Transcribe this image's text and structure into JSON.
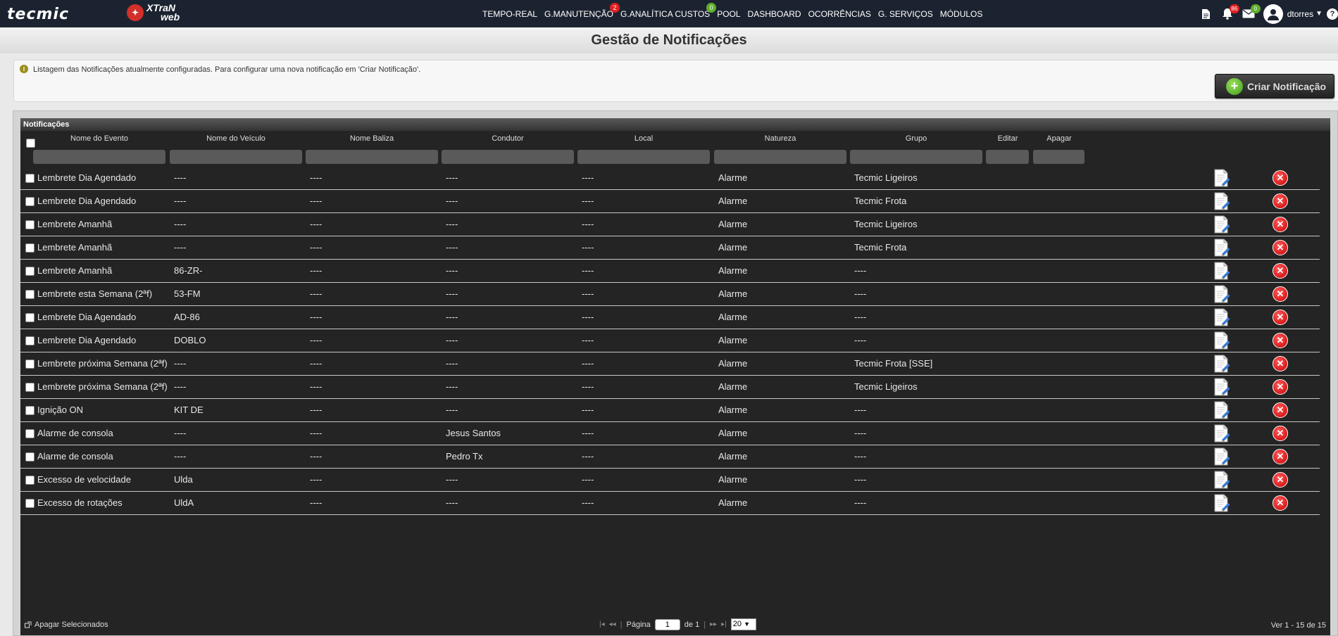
{
  "brand": {
    "tecmic": "tecmic",
    "xtran_line1": "XTraN",
    "xtran_line2": "web"
  },
  "nav": [
    {
      "label": "TEMPO-REAL"
    },
    {
      "label": "G.MANUTENÇÃO",
      "badge": "2",
      "badge_color": "#e02020"
    },
    {
      "label": "G.ANALÍTICA CUSTOS",
      "badge": "0",
      "badge_color": "#5fae2c"
    },
    {
      "label": "POOL"
    },
    {
      "label": "DASHBOARD"
    },
    {
      "label": "OCORRÊNCIAS"
    },
    {
      "label": "G. SERVIÇOS"
    },
    {
      "label": "MÓDULOS"
    }
  ],
  "tools": {
    "bell_badge": "86",
    "mail_badge": "0",
    "username": "dtorres",
    "help": "?"
  },
  "page_title": "Gestão de Notificações",
  "info_text": "Listagem das Notificações atualmente configuradas. Para configurar uma nova notificação em 'Criar Notificação'.",
  "create_button": "Criar Notificação",
  "grid": {
    "caption": "Notificações",
    "columns": [
      "Nome do Evento",
      "Nome do Veículo",
      "Nome Baliza",
      "Condutor",
      "Local",
      "Natureza",
      "Grupo",
      "Editar",
      "Apagar"
    ],
    "rows": [
      [
        "Lembrete Dia Agendado",
        "----",
        "----",
        "----",
        "----",
        "Alarme",
        "Tecmic Ligeiros"
      ],
      [
        "Lembrete Dia Agendado",
        "----",
        "----",
        "----",
        "----",
        "Alarme",
        "Tecmic Frota"
      ],
      [
        "Lembrete Amanhã",
        "----",
        "----",
        "----",
        "----",
        "Alarme",
        "Tecmic Ligeiros"
      ],
      [
        "Lembrete Amanhã",
        "----",
        "----",
        "----",
        "----",
        "Alarme",
        "Tecmic Frota"
      ],
      [
        "Lembrete Amanhã",
        "86-ZR-",
        "----",
        "----",
        "----",
        "Alarme",
        "----"
      ],
      [
        "Lembrete esta Semana (2ªf)",
        "53-FM",
        "----",
        "----",
        "----",
        "Alarme",
        "----"
      ],
      [
        "Lembrete Dia Agendado",
        "AD-86",
        "----",
        "----",
        "----",
        "Alarme",
        "----"
      ],
      [
        "Lembrete Dia Agendado",
        "DOBLO",
        "----",
        "----",
        "----",
        "Alarme",
        "----"
      ],
      [
        "Lembrete próxima Semana (2ªf)",
        "----",
        "----",
        "----",
        "----",
        "Alarme",
        "Tecmic Frota [SSE]"
      ],
      [
        "Lembrete próxima Semana (2ªf)",
        "----",
        "----",
        "----",
        "----",
        "Alarme",
        "Tecmic Ligeiros"
      ],
      [
        "Ignição ON",
        "KIT DE",
        "----",
        "----",
        "----",
        "Alarme",
        "----"
      ],
      [
        "Alarme de consola",
        "----",
        "----",
        "Jesus Santos",
        "----",
        "Alarme",
        "----"
      ],
      [
        "Alarme de consola",
        "----",
        "----",
        "Pedro Tx",
        "----",
        "Alarme",
        "----"
      ],
      [
        "Excesso de velocidade",
        "Ulda",
        "----",
        "----",
        "----",
        "Alarme",
        "----"
      ],
      [
        "Excesso de rotações",
        "UldA",
        "----",
        "----",
        "----",
        "Alarme",
        "----"
      ]
    ]
  },
  "footer": {
    "delete_selected": "Apagar Selecionados",
    "page_label": "Página",
    "page_value": "1",
    "of_label": "de 1",
    "page_size": "20",
    "records": "Ver 1 - 15 de 15"
  }
}
